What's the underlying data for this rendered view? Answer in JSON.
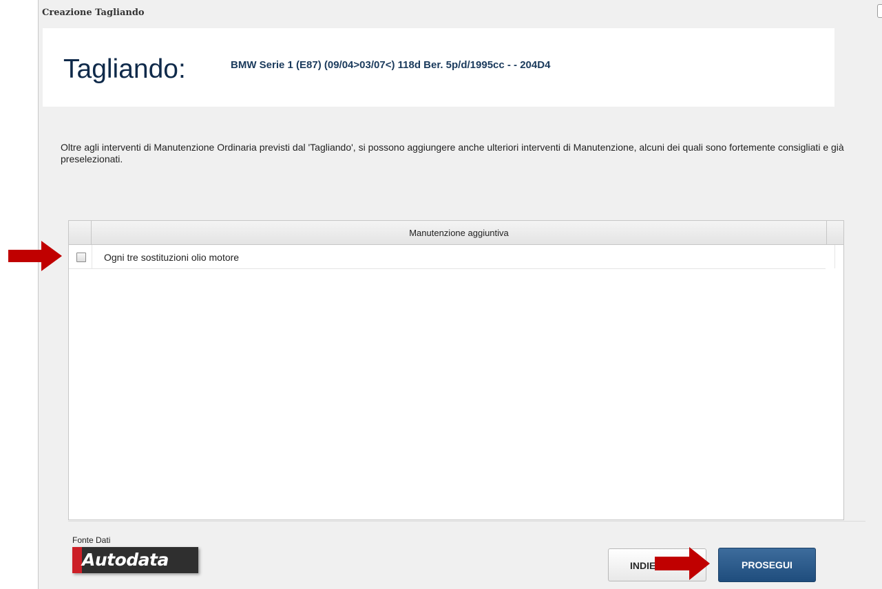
{
  "dialog": {
    "title": "Creazione Tagliando"
  },
  "header": {
    "label": "Tagliando:",
    "vehicle": "BMW Serie 1 (E87) (09/04>03/07<) 118d Ber. 5p/d/1995cc - - 204D4"
  },
  "description": "Oltre agli interventi di Manutenzione Ordinaria previsti dal 'Tagliando', si possono aggiungere anche ulteriori interventi di Manutenzione, alcuni dei quali sono fortemente consigliati e già preselezionati.",
  "table": {
    "column_header": "Manutenzione aggiuntiva",
    "rows": [
      {
        "label": "Ogni tre sostituzioni olio motore",
        "checked": false
      }
    ]
  },
  "footer": {
    "source_label": "Fonte Dati",
    "logo_text": "Autodata",
    "back_button": "INDIETRO",
    "next_button": "PROSEGUI"
  },
  "colors": {
    "accent": "#1f4d7d",
    "annotation_arrow": "#c00000",
    "logo_red": "#cc1f27"
  },
  "icons": {
    "annotation": "arrow-right-icon"
  }
}
